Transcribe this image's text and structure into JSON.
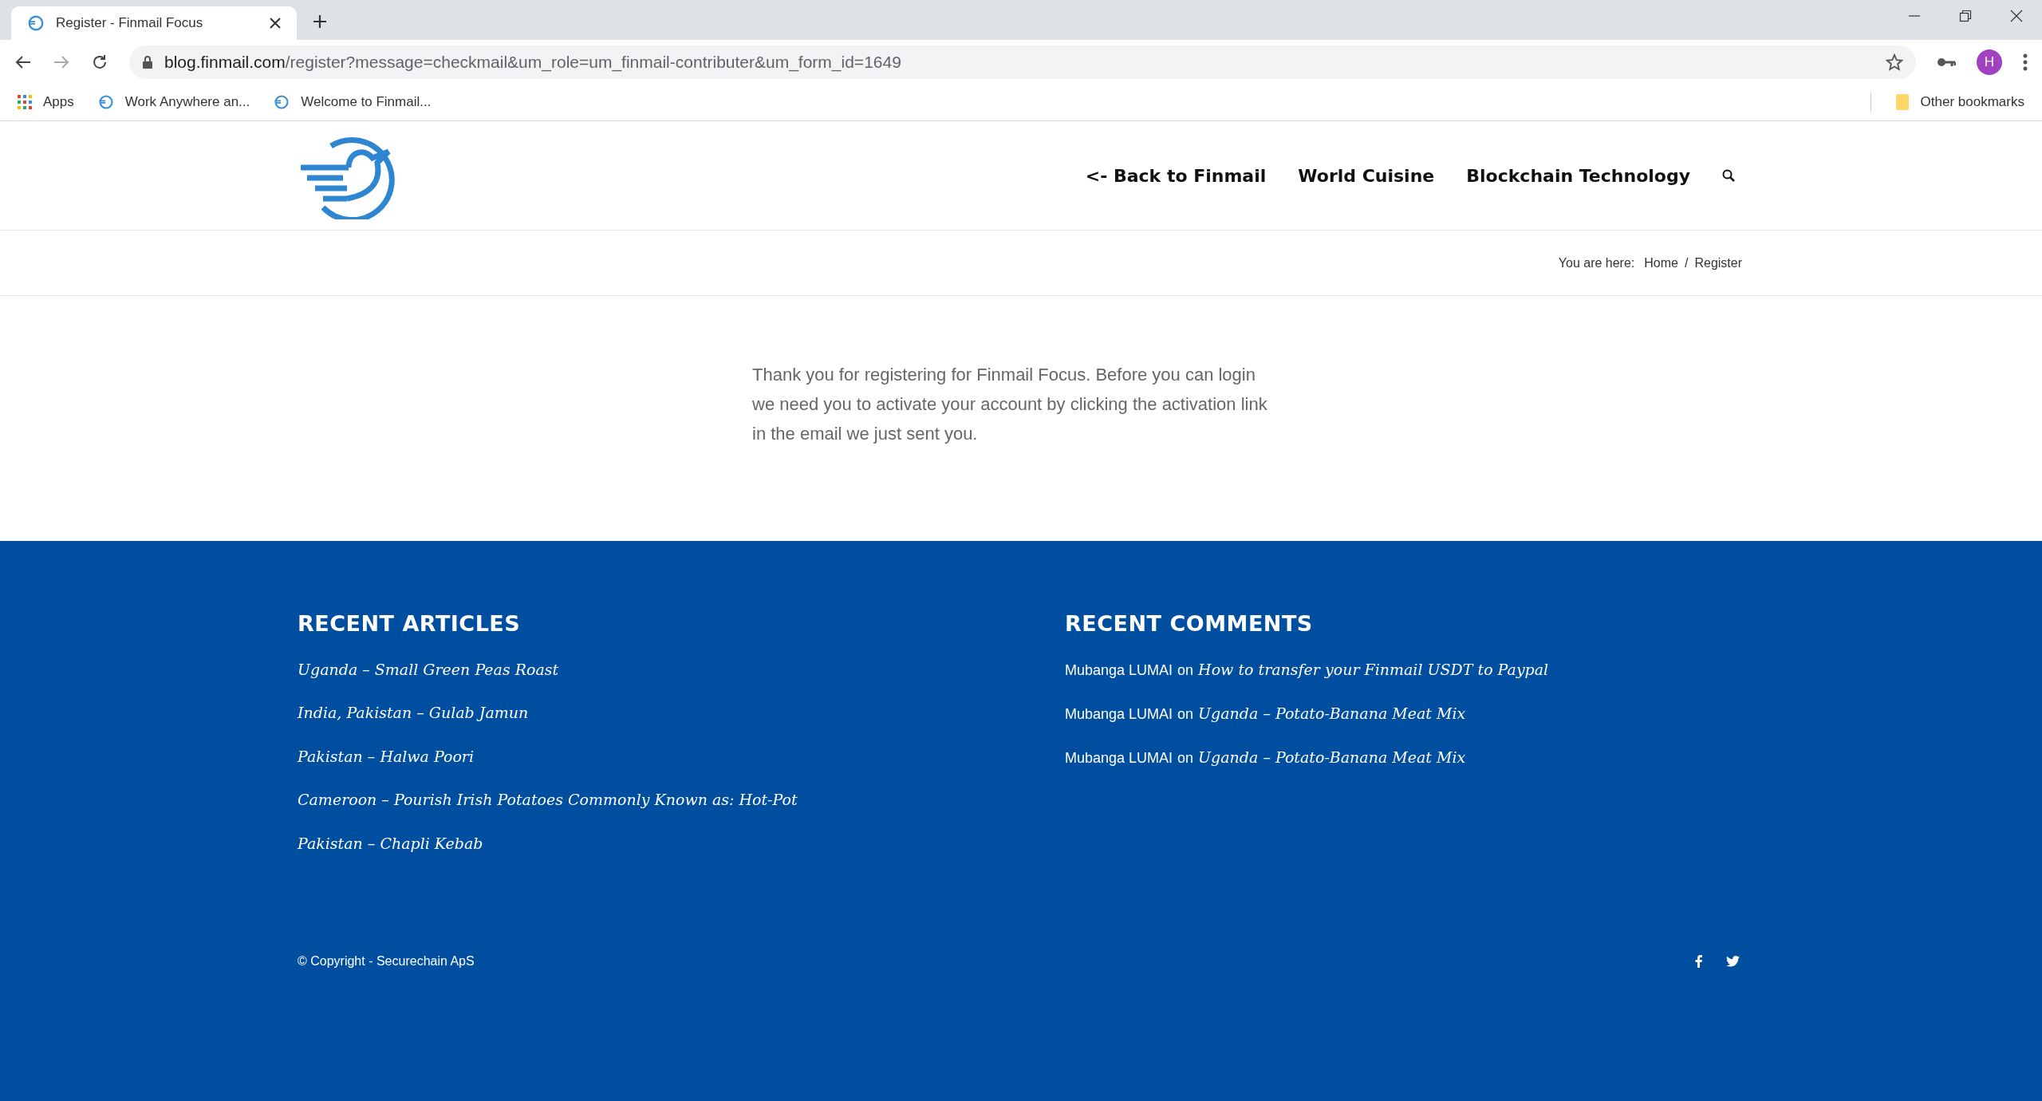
{
  "browser": {
    "tab": {
      "title": "Register - Finmail Focus",
      "selected": true
    },
    "url": {
      "host": "blog.finmail.com",
      "path": "/register?message=checkmail&um_role=um_finmail-contributer&um_form_id=1649"
    },
    "profile_initial": "H",
    "bookmarks": [
      {
        "label": "Apps",
        "kind": "apps"
      },
      {
        "label": "Work Anywhere an...",
        "kind": "site"
      },
      {
        "label": "Welcome to Finmail...",
        "kind": "site"
      }
    ],
    "other_bookmarks": "Other bookmarks"
  },
  "nav": {
    "items": [
      "<- Back to Finmail",
      "World Cuisine",
      "Blockchain Technology"
    ]
  },
  "breadcrumb": {
    "prefix": "You are here:",
    "items": [
      "Home",
      "Register"
    ],
    "separator": "/"
  },
  "message": "Thank you for registering for Finmail Focus. Before you can login we need you to activate your account by clicking the activation link in the email we just sent you.",
  "footer": {
    "recent_articles": {
      "title": "RECENT ARTICLES",
      "items": [
        "Uganda – Small Green Peas Roast",
        "India, Pakistan – Gulab Jamun",
        "Pakistan – Halwa Poori",
        "Cameroon – Pourish Irish Potatoes Commonly Known as: Hot-Pot",
        "Pakistan – Chapli Kebab"
      ]
    },
    "recent_comments": {
      "title": "RECENT COMMENTS",
      "items": [
        {
          "author": "Mubanga LUMAI",
          "connector": "on",
          "post": "How to transfer your Finmail USDT to Paypal"
        },
        {
          "author": "Mubanga LUMAI",
          "connector": "on",
          "post": "Uganda – Potato-Banana Meat Mix"
        },
        {
          "author": "Mubanga LUMAI",
          "connector": "on",
          "post": "Uganda – Potato-Banana Meat Mix"
        }
      ]
    },
    "copyright": "© Copyright - Securechain ApS",
    "social": [
      {
        "kind": "facebook"
      },
      {
        "kind": "twitter"
      }
    ]
  }
}
